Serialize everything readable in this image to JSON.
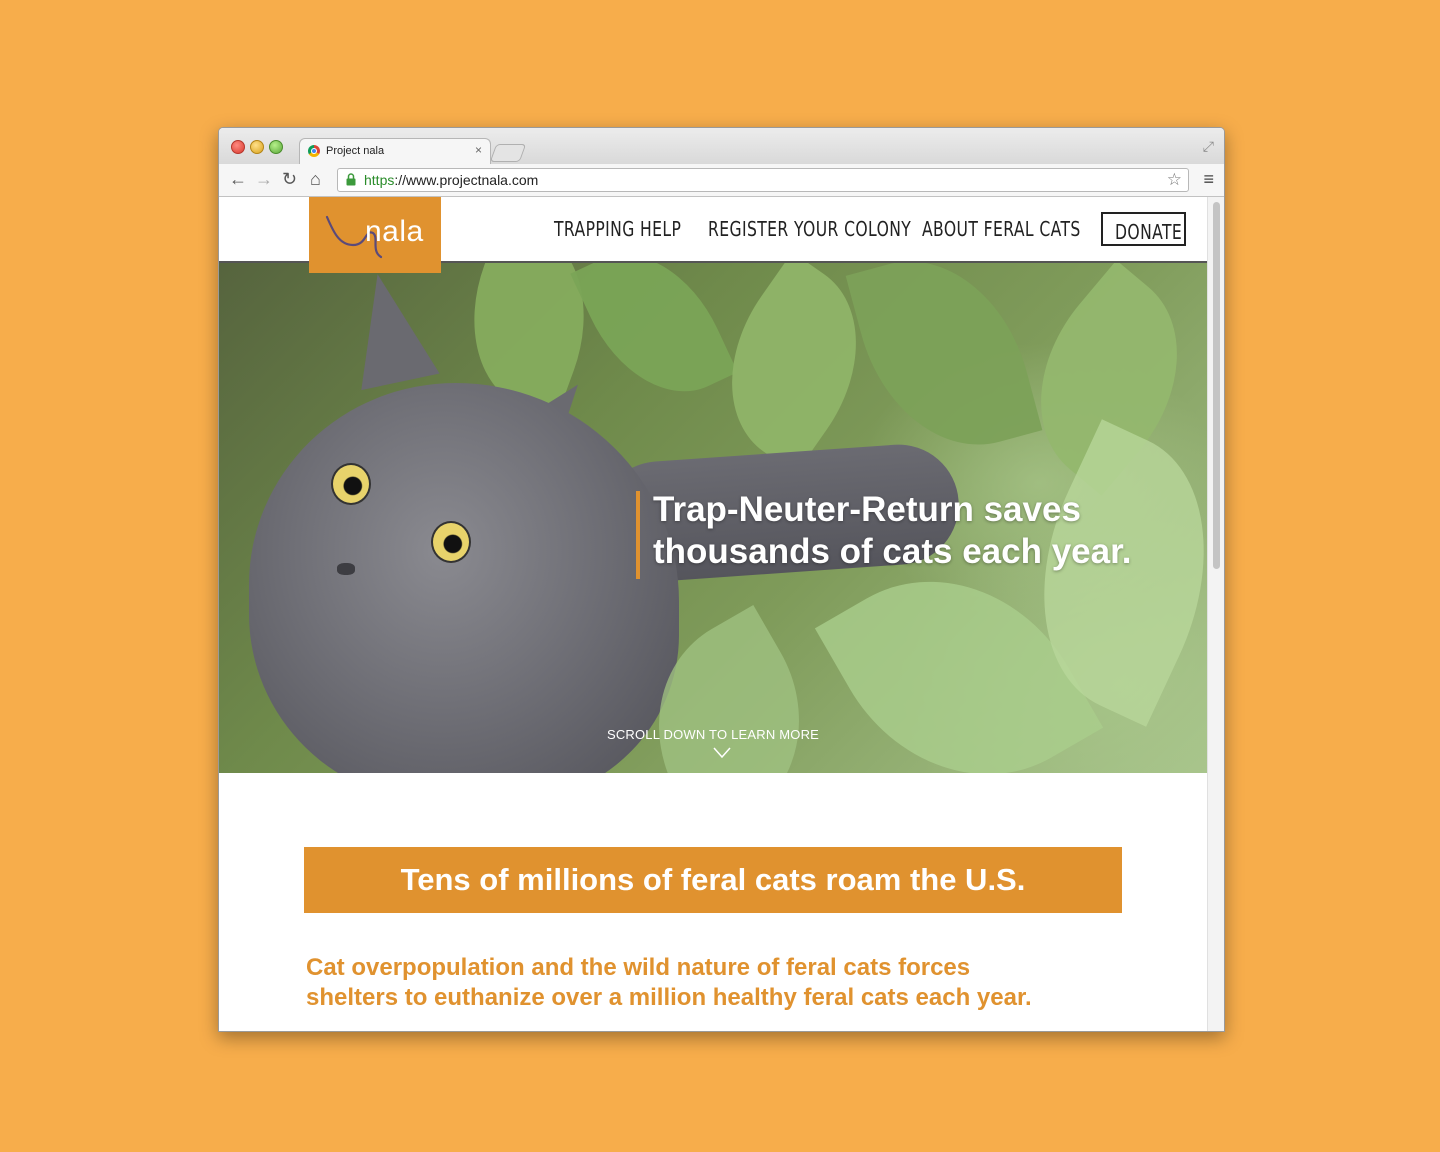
{
  "browser": {
    "tab_title": "Project nala",
    "tab_close": "×",
    "url_scheme": "https",
    "url_rest": "://www.projectnala.com"
  },
  "site": {
    "logo_text": "nala",
    "nav": {
      "trapping": "TRAPPING HELP",
      "register": "REGISTER YOUR COLONY",
      "about": "ABOUT FERAL CATS",
      "donate": "DONATE"
    },
    "hero": {
      "line1": "Trap-Neuter-Return saves",
      "line2": "thousands of cats each year.",
      "scroll_hint": "SCROLL DOWN TO LEARN MORE"
    },
    "banner": "Tens of millions of feral cats roam the U.S.",
    "lead": {
      "line1": "Cat overpopulation and the wild nature of feral cats forces",
      "line2": "shelters to euthanize over a million healthy feral cats each year."
    }
  },
  "colors": {
    "background": "#f7ad4b",
    "brand_orange": "#e0922f",
    "url_scheme_green": "#2a8c2a"
  }
}
